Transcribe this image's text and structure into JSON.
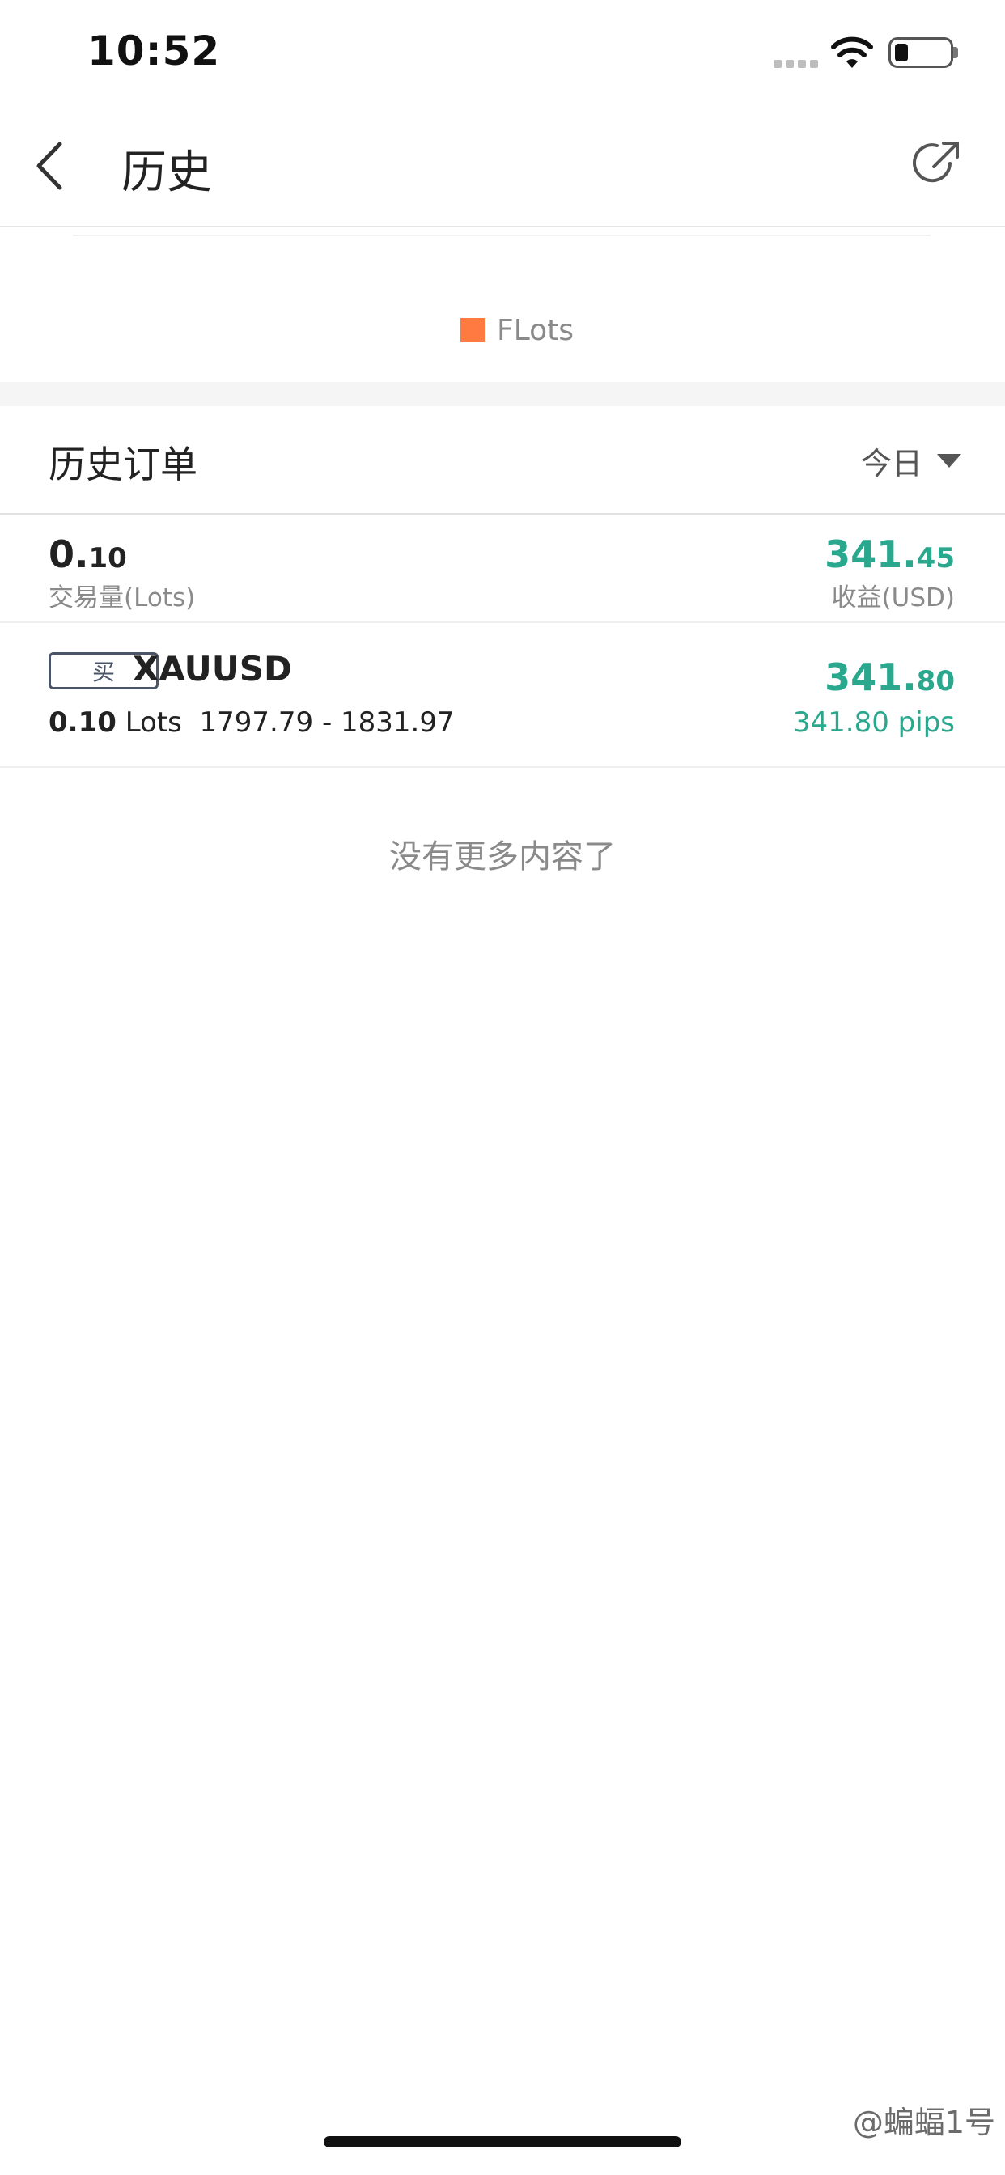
{
  "status_bar": {
    "time": "10:52"
  },
  "nav": {
    "title": "历史",
    "back_icon": "chevron-left-icon",
    "share_icon": "share-circle-icon"
  },
  "legend": {
    "label": "FLots",
    "color": "#ff7a40"
  },
  "section": {
    "title": "历史订单",
    "filter": "今日"
  },
  "summary": {
    "lots_int": "0.",
    "lots_dec": "10",
    "lots_label": "交易量(Lots)",
    "profit_int": "341.",
    "profit_dec": "45",
    "profit_label": "收益(USD)"
  },
  "orders": [
    {
      "side": "买",
      "symbol": "XAUUSD",
      "lots": "0.10",
      "lots_unit": "Lots",
      "price_range": "1797.79 - 1831.97",
      "profit_int": "341.",
      "profit_dec": "80",
      "pips": "341.80 pips"
    }
  ],
  "footer_note": "没有更多内容了",
  "watermark": "@蝙蝠1号",
  "colors": {
    "profit": "#2aa88e",
    "accent": "#ff7a40"
  }
}
